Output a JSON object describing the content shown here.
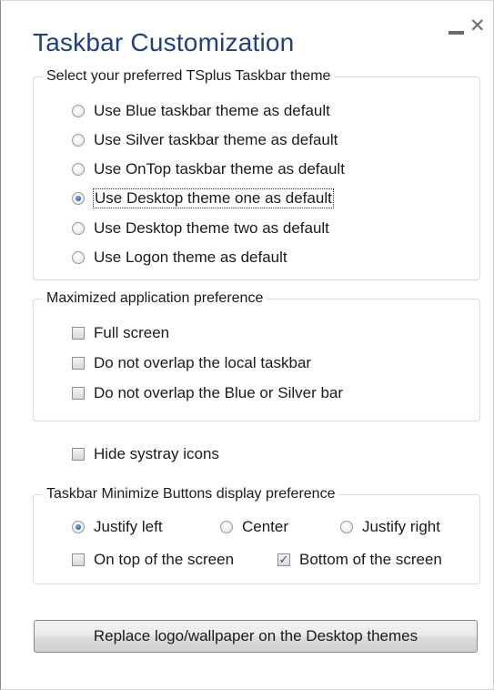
{
  "window": {
    "title": "Taskbar Customization",
    "minimize_label": "",
    "close_label": "✕"
  },
  "theme_group": {
    "legend": "Select your preferred TSplus Taskbar theme",
    "options": [
      {
        "label": "Use Blue taskbar theme as default",
        "checked": false
      },
      {
        "label": "Use Silver taskbar theme as default",
        "checked": false
      },
      {
        "label": "Use OnTop taskbar theme as default",
        "checked": false
      },
      {
        "label": "Use Desktop theme one as default",
        "checked": true
      },
      {
        "label": "Use Desktop theme two as default",
        "checked": false
      },
      {
        "label": "Use Logon theme as default",
        "checked": false
      }
    ]
  },
  "maximized_group": {
    "legend": "Maximized application preference",
    "options": [
      {
        "label": "Full screen",
        "checked": false
      },
      {
        "label": "Do not overlap the local taskbar",
        "checked": false
      },
      {
        "label": "Do not overlap the Blue or Silver bar",
        "checked": false
      }
    ]
  },
  "hide_systray": {
    "label": "Hide systray icons",
    "checked": false
  },
  "minimize_group": {
    "legend": "Taskbar Minimize Buttons display preference",
    "alignment": [
      {
        "label": "Justify left",
        "checked": true
      },
      {
        "label": "Center",
        "checked": false
      },
      {
        "label": "Justify right",
        "checked": false
      }
    ],
    "position": [
      {
        "label": "On top of the screen",
        "checked": false
      },
      {
        "label": "Bottom of the screen",
        "checked": true
      }
    ]
  },
  "replace_button": {
    "label": "Replace logo/wallpaper on the Desktop themes"
  },
  "colors": {
    "title": "#1f3f86",
    "radio_dot": "#2a6fc4",
    "check_mark": "#2a4f8c"
  }
}
